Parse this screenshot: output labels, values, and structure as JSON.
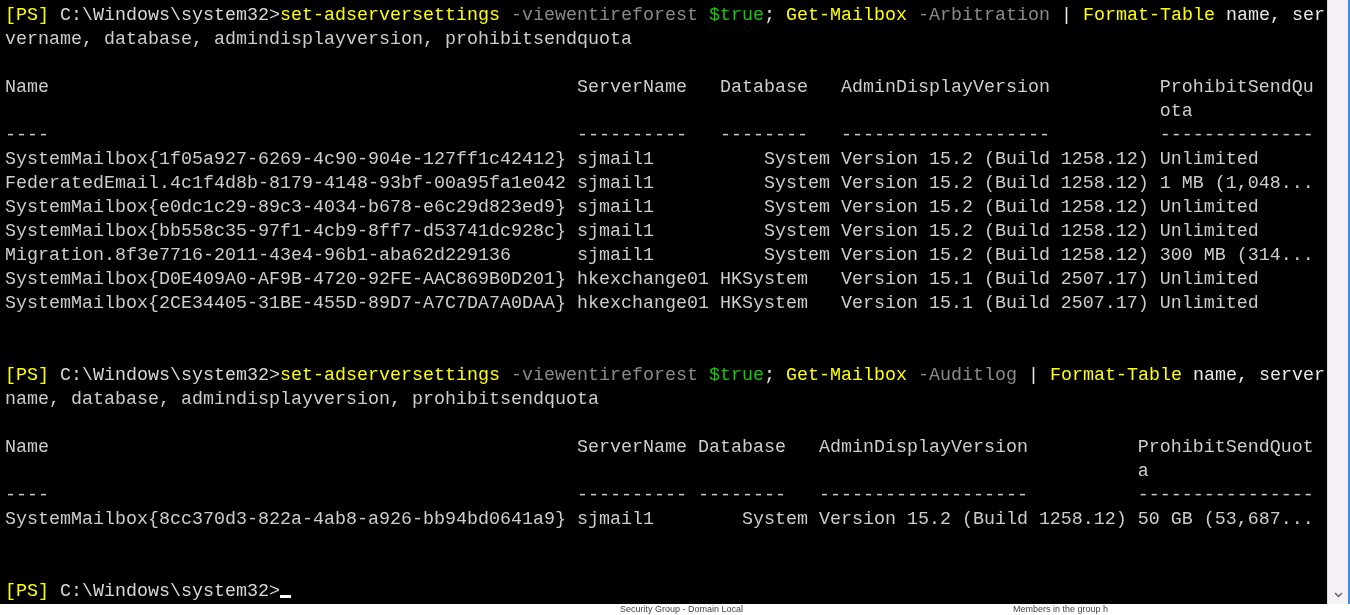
{
  "console": {
    "lines": [
      {
        "kind": "command",
        "segments": [
          {
            "kind": "prompt",
            "text": "[PS]"
          },
          {
            "kind": "path",
            "text": " C:\\Windows\\system32>"
          },
          {
            "kind": "cmdlet",
            "text": "set-adserversettings"
          },
          {
            "kind": "parameter",
            "text": " -viewentireforest"
          },
          {
            "kind": "variable",
            "text": " $true"
          },
          {
            "kind": "text",
            "text": "; "
          },
          {
            "kind": "cmdlet",
            "text": "Get-Mailbox"
          },
          {
            "kind": "parameter",
            "text": " -Arbitration"
          },
          {
            "kind": "text",
            "text": " | "
          },
          {
            "kind": "cmdlet",
            "text": "Format-Table"
          },
          {
            "kind": "text",
            "text": " name, ser"
          }
        ]
      },
      {
        "kind": "output",
        "text": "vername, database, admindisplayversion, prohibitsendquota"
      },
      {
        "kind": "blank"
      },
      {
        "kind": "output",
        "text": "Name                                                ServerName   Database   AdminDisplayVersion          ProhibitSendQu"
      },
      {
        "kind": "output",
        "text": "                                                                                                         ota"
      },
      {
        "kind": "output",
        "text": "----                                                ----------   --------   -------------------          --------------"
      },
      {
        "kind": "output",
        "text": "SystemMailbox{1f05a927-6269-4c90-904e-127ff1c42412} sjmail1          System Version 15.2 (Build 1258.12) Unlimited"
      },
      {
        "kind": "output",
        "text": "FederatedEmail.4c1f4d8b-8179-4148-93bf-00a95fa1e042 sjmail1          System Version 15.2 (Build 1258.12) 1 MB (1,048..."
      },
      {
        "kind": "output",
        "text": "SystemMailbox{e0dc1c29-89c3-4034-b678-e6c29d823ed9} sjmail1          System Version 15.2 (Build 1258.12) Unlimited"
      },
      {
        "kind": "output",
        "text": "SystemMailbox{bb558c35-97f1-4cb9-8ff7-d53741dc928c} sjmail1          System Version 15.2 (Build 1258.12) Unlimited"
      },
      {
        "kind": "output",
        "text": "Migration.8f3e7716-2011-43e4-96b1-aba62d229136      sjmail1          System Version 15.2 (Build 1258.12) 300 MB (314..."
      },
      {
        "kind": "output",
        "text": "SystemMailbox{D0E409A0-AF9B-4720-92FE-AAC869B0D201} hkexchange01 HKSystem   Version 15.1 (Build 2507.17) Unlimited"
      },
      {
        "kind": "output",
        "text": "SystemMailbox{2CE34405-31BE-455D-89D7-A7C7DA7A0DAA} hkexchange01 HKSystem   Version 15.1 (Build 2507.17) Unlimited"
      },
      {
        "kind": "blank"
      },
      {
        "kind": "blank"
      },
      {
        "kind": "command",
        "segments": [
          {
            "kind": "prompt",
            "text": "[PS]"
          },
          {
            "kind": "path",
            "text": " C:\\Windows\\system32>"
          },
          {
            "kind": "cmdlet",
            "text": "set-adserversettings"
          },
          {
            "kind": "parameter",
            "text": " -viewentireforest"
          },
          {
            "kind": "variable",
            "text": " $true"
          },
          {
            "kind": "text",
            "text": "; "
          },
          {
            "kind": "cmdlet",
            "text": "Get-Mailbox"
          },
          {
            "kind": "parameter",
            "text": " -Auditlog"
          },
          {
            "kind": "text",
            "text": " | "
          },
          {
            "kind": "cmdlet",
            "text": "Format-Table"
          },
          {
            "kind": "text",
            "text": " name, server"
          }
        ]
      },
      {
        "kind": "output",
        "text": "name, database, admindisplayversion, prohibitsendquota"
      },
      {
        "kind": "blank"
      },
      {
        "kind": "output",
        "text": "Name                                                ServerName Database   AdminDisplayVersion          ProhibitSendQuot"
      },
      {
        "kind": "output",
        "text": "                                                                                                       a"
      },
      {
        "kind": "output",
        "text": "----                                                ---------- --------   -------------------          ----------------"
      },
      {
        "kind": "output",
        "text": "SystemMailbox{8cc370d3-822a-4ab8-a926-bb94bd0641a9} sjmail1        System Version 15.2 (Build 1258.12) 50 GB (53,687..."
      },
      {
        "kind": "blank"
      },
      {
        "kind": "blank"
      },
      {
        "kind": "command",
        "cursor": true,
        "segments": [
          {
            "kind": "prompt",
            "text": "[PS]"
          },
          {
            "kind": "path",
            "text": " C:\\Windows\\system32>"
          }
        ]
      }
    ]
  },
  "background_window": {
    "texts": [
      "Security Group - Domain Local",
      "Members in the group h"
    ]
  }
}
